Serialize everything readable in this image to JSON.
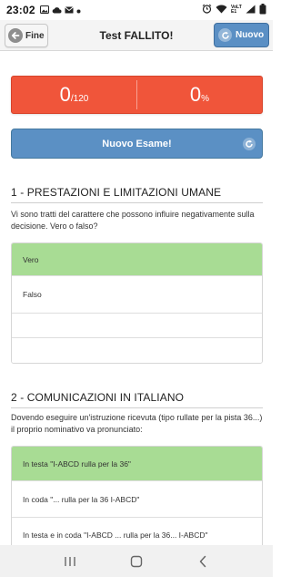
{
  "status_bar": {
    "time": "23:02",
    "icons_left": [
      "photo-icon",
      "cloud-icon",
      "mail-icon",
      "dot-icon"
    ],
    "icons_right": [
      "alarm-icon",
      "wifi-icon",
      "signal-icon",
      "battery-icon"
    ],
    "network_label": "VoLTE1"
  },
  "header": {
    "back_label": "Fine",
    "title": "Test FALLITO!",
    "new_label": "Nuovo"
  },
  "score": {
    "correct": "0",
    "total": "/120",
    "percent": "0",
    "percent_sign": "%",
    "color": "#f0553a"
  },
  "new_exam_label": "Nuovo Esame!",
  "sections": [
    {
      "title": "1 - PRESTAZIONI E LIMITAZIONI UMANE",
      "question": "Vi sono tratti del carattere che possono influire negativamente sulla decisione. Vero o falso?",
      "answers": [
        {
          "text": "Vero",
          "correct": true
        },
        {
          "text": "Falso",
          "correct": false
        },
        {
          "text": "",
          "correct": false
        },
        {
          "text": "",
          "correct": false
        }
      ]
    },
    {
      "title": "2 - COMUNICAZIONI IN ITALIANO",
      "question": "Dovendo eseguire un'istruzione ricevuta (tipo rullate per la pista 36...) il proprio nominativo va pronunciato:",
      "answers": [
        {
          "text": "In testa \"I-ABCD rulla per la 36\"",
          "correct": true
        },
        {
          "text": "In coda \"... rulla per la 36 I-ABCD\"",
          "correct": false
        },
        {
          "text": "In testa e in coda \"I-ABCD ... rulla per la 36... I-ABCD\"",
          "correct": false
        }
      ]
    }
  ],
  "colors": {
    "accent": "#5b90c4",
    "correct_answer": "#a8dc94",
    "failure": "#f0553a"
  },
  "nav_bar": {
    "buttons": [
      "recent-apps-icon",
      "home-icon",
      "back-icon"
    ]
  }
}
